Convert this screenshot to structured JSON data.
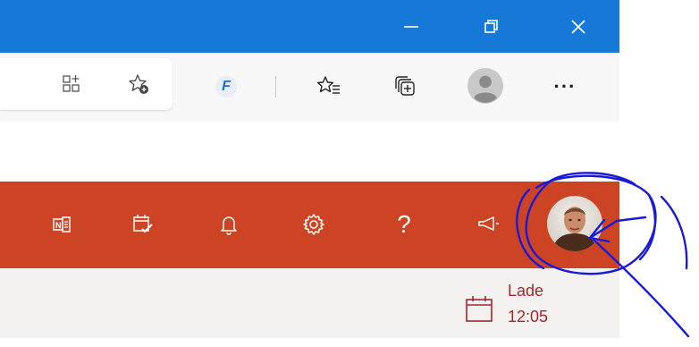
{
  "window": {
    "controls": [
      {
        "name": "minimize-icon"
      },
      {
        "name": "restore-icon"
      },
      {
        "name": "close-icon"
      }
    ]
  },
  "toolbar": {
    "overflow_glyph": "···",
    "extension_letter": "F"
  },
  "office_bar": {
    "help_glyph": "?",
    "icons": [
      "onenote-icon",
      "task-calendar-icon",
      "bell-icon",
      "gear-icon",
      "help-icon",
      "megaphone-icon"
    ]
  },
  "calendar": {
    "label": "Lade",
    "time": "12:05"
  },
  "colors": {
    "titlebar": "#1679d7",
    "office_bar": "#cd4425",
    "calendar_text": "#a4262c",
    "annotation_ink": "#1a1ad6"
  }
}
